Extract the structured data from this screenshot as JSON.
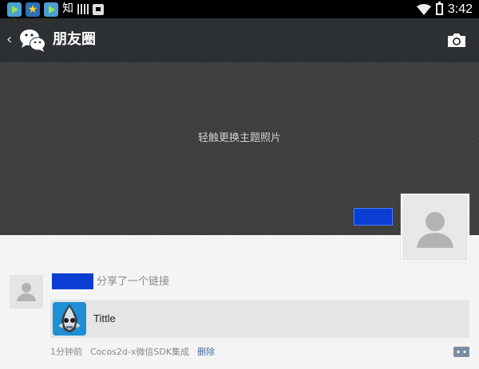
{
  "status_bar": {
    "notification_icons": [
      "play-store-icon",
      "star-app-icon",
      "play-store-icon"
    ],
    "notification_text": "知",
    "time": "3:42"
  },
  "action_bar": {
    "title": "朋友圈",
    "back_glyph": "‹"
  },
  "cover": {
    "hint": "轻触更换主题照片"
  },
  "feed_item": {
    "action_text": "分享了一个链接",
    "link": {
      "title": "Tittle"
    },
    "meta": {
      "time": "1分钟前",
      "source": "Cocos2d-x微信SDK集成",
      "delete_label": "删除"
    }
  },
  "colors": {
    "action_bar_bg": "#2c3032",
    "cover_bg": "#3e3e3e",
    "redaction_blue": "#0a3ed2",
    "link_card_bg": "#e5e5e5",
    "delete_link": "#4a6a9a"
  }
}
